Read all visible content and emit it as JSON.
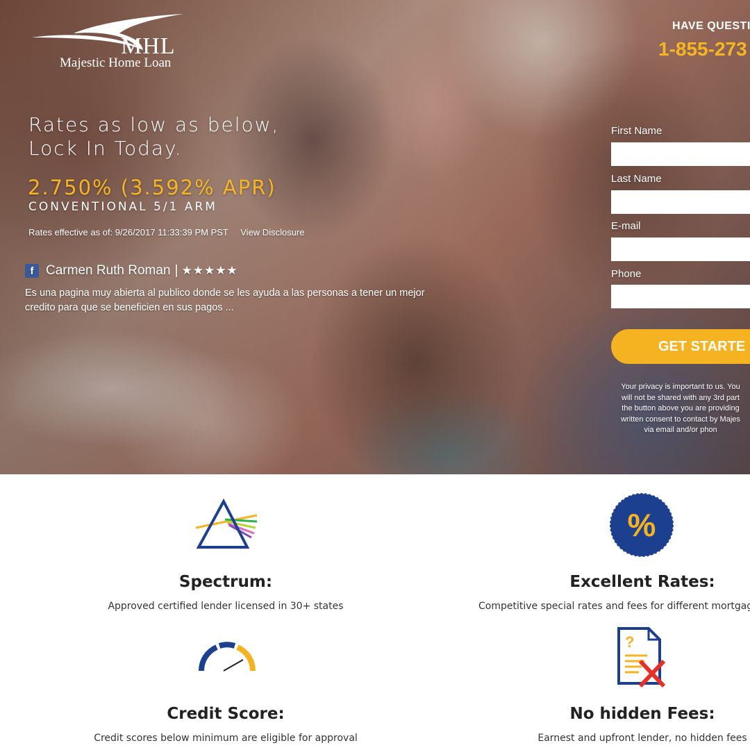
{
  "brand": {
    "abbr": "MHL",
    "name": "Majestic Home Loan"
  },
  "contact": {
    "question": "HAVE QUESTI",
    "phone": "1-855-273"
  },
  "hero": {
    "headline_line1": "Rates as low as below,",
    "headline_line2": "Lock In Today.",
    "rate": "2.750% (3.592% APR)",
    "product": "CONVENTIONAL 5/1 ARM",
    "effective": "Rates effective as of: 9/26/2017 11:33:39 PM PST",
    "disclosure_link": "View Disclosure"
  },
  "review": {
    "icon": "facebook-icon",
    "author": "Carmen Ruth Roman",
    "separator": "|",
    "stars": "★★★★★",
    "text": "Es una pagina muy abierta al publico donde se les ayuda a las personas a tener un mejor credito para que se beneficien en sus pagos ..."
  },
  "form": {
    "first_name_label": "First Name",
    "last_name_label": "Last Name",
    "email_label": "E-mail",
    "phone_label": "Phone",
    "first_name_value": "",
    "last_name_value": "",
    "email_value": "",
    "phone_value": "",
    "submit_label": "GET STARTE",
    "privacy_lines": [
      "Your privacy is important to us. You",
      "will not be shared with any 3rd part",
      "the button above you are providing",
      "written consent to contact by Majes",
      "via email and/or phon"
    ]
  },
  "features": [
    {
      "icon": "prism-icon",
      "title": "Spectrum:",
      "desc": "Approved certified lender licensed in 30+ states"
    },
    {
      "icon": "percent-badge-icon",
      "title": "Excellent Rates:",
      "desc": "Competitive special rates and fees for different mortgag"
    },
    {
      "icon": "gauge-icon",
      "title": "Credit Score:",
      "desc": "Credit scores below minimum are eligible for approval"
    },
    {
      "icon": "document-x-icon",
      "title": "No hidden Fees:",
      "desc": "Earnest and upfront lender, no hidden fees"
    }
  ],
  "colors": {
    "accent": "#f5b221",
    "navy": "#1d3f8f",
    "facebook": "#3b5998",
    "red": "#e53027"
  }
}
